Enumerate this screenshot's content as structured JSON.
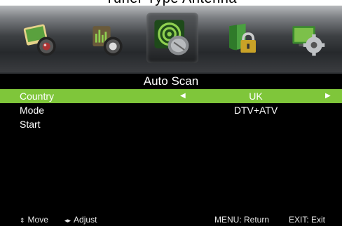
{
  "top_caption": "Tuner Type Antenna",
  "icons": [
    {
      "name": "picture-icon",
      "selected": false
    },
    {
      "name": "sound-icon",
      "selected": false
    },
    {
      "name": "channel-icon",
      "selected": true
    },
    {
      "name": "lock-icon",
      "selected": false
    },
    {
      "name": "setup-icon",
      "selected": false
    }
  ],
  "screen_title": "Auto Scan",
  "rows": [
    {
      "label": "Country",
      "value": "UK",
      "selected": true
    },
    {
      "label": "Mode",
      "value": "DTV+ATV",
      "selected": false
    },
    {
      "label": "Start",
      "value": "",
      "selected": false
    }
  ],
  "arrows": {
    "left": "◀",
    "right": "▶"
  },
  "footer": {
    "move_icon": "⇕",
    "move": "Move",
    "adjust_icon": "◂▸",
    "adjust": "Adjust",
    "menu": "MENU: Return",
    "exit": "EXIT: Exit"
  },
  "colors": {
    "highlight": "#7fc63a",
    "background": "#000000"
  }
}
